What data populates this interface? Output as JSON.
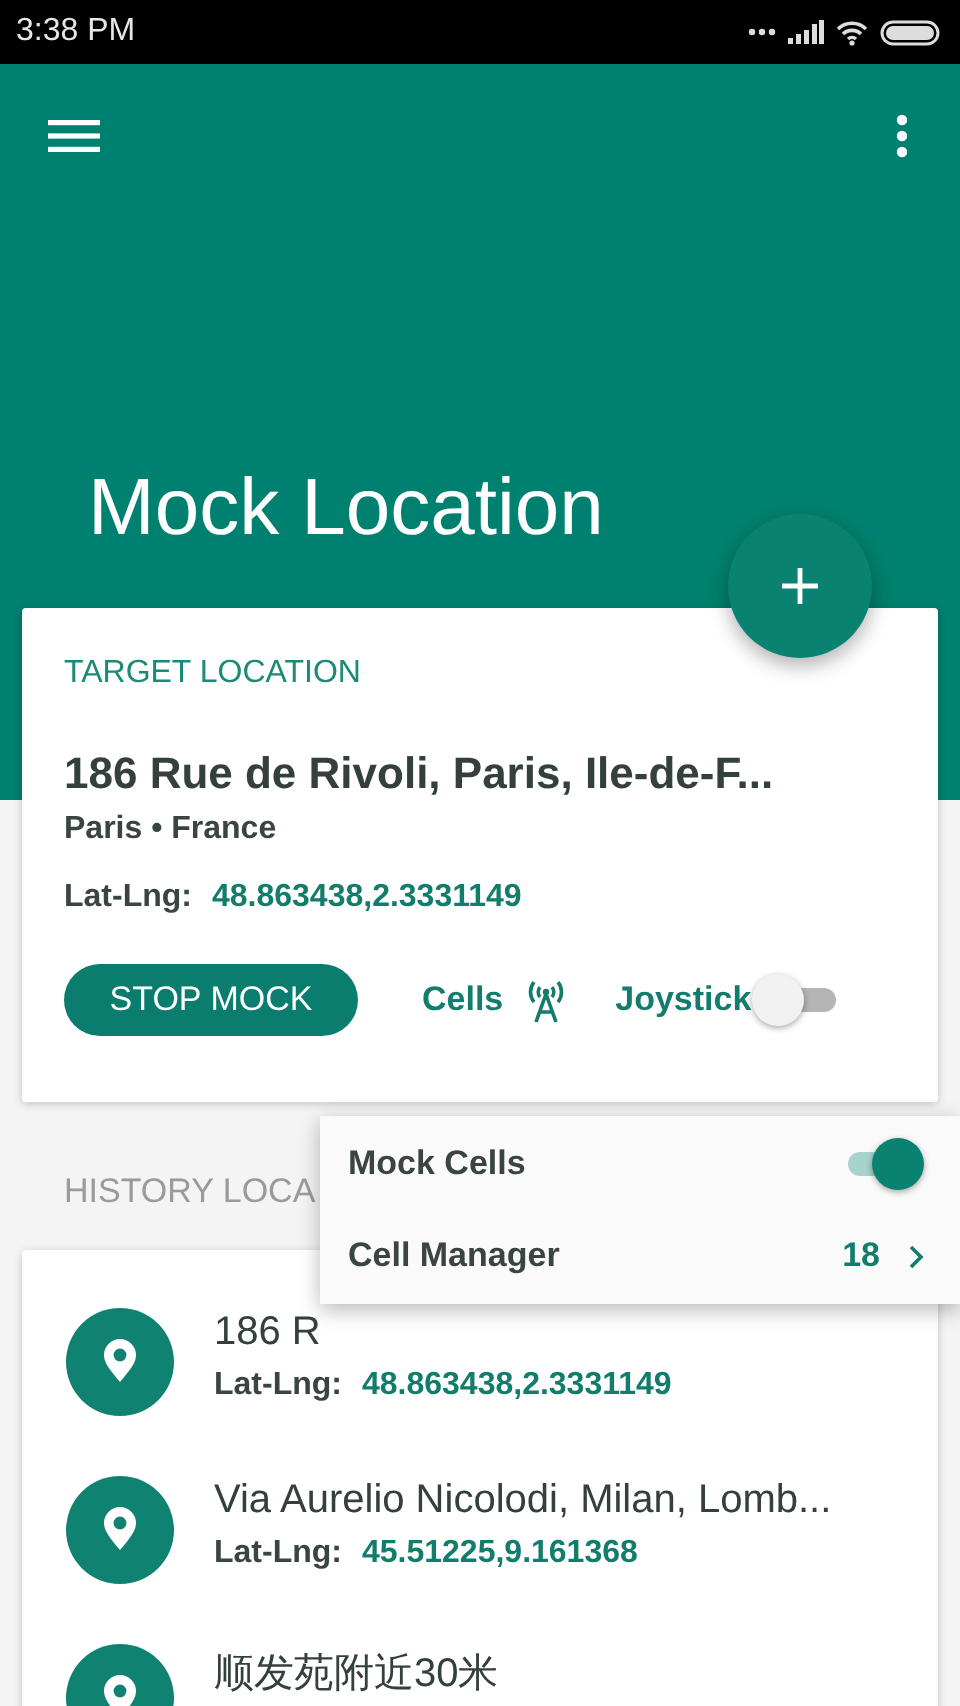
{
  "status_bar": {
    "time": "3:38 PM"
  },
  "app_bar": {
    "title": "Mock Location"
  },
  "target": {
    "heading": "TARGET LOCATION",
    "address": "186 Rue de Rivoli, Paris, Ile-de-F...",
    "place": "Paris • France",
    "latlng_label": "Lat-Lng:",
    "latlng": "48.863438,2.3331149",
    "button": "STOP MOCK",
    "cells_label": "Cells",
    "joystick": {
      "label": "Joystick",
      "on": false
    }
  },
  "history": {
    "heading": "HISTORY LOCA",
    "items": [
      {
        "title": "186 R",
        "latlng_label": "Lat-Lng:",
        "latlng": "48.863438,2.3331149"
      },
      {
        "title": "Via Aurelio Nicolodi, Milan, Lomb...",
        "latlng_label": "Lat-Lng:",
        "latlng": "45.51225,9.161368"
      },
      {
        "title": "顺发苑附近30米"
      }
    ]
  },
  "popup": {
    "items": [
      {
        "kind": "switch",
        "label": "Mock Cells",
        "on": true
      },
      {
        "kind": "link",
        "label": "Cell Manager",
        "count": "18"
      }
    ]
  }
}
